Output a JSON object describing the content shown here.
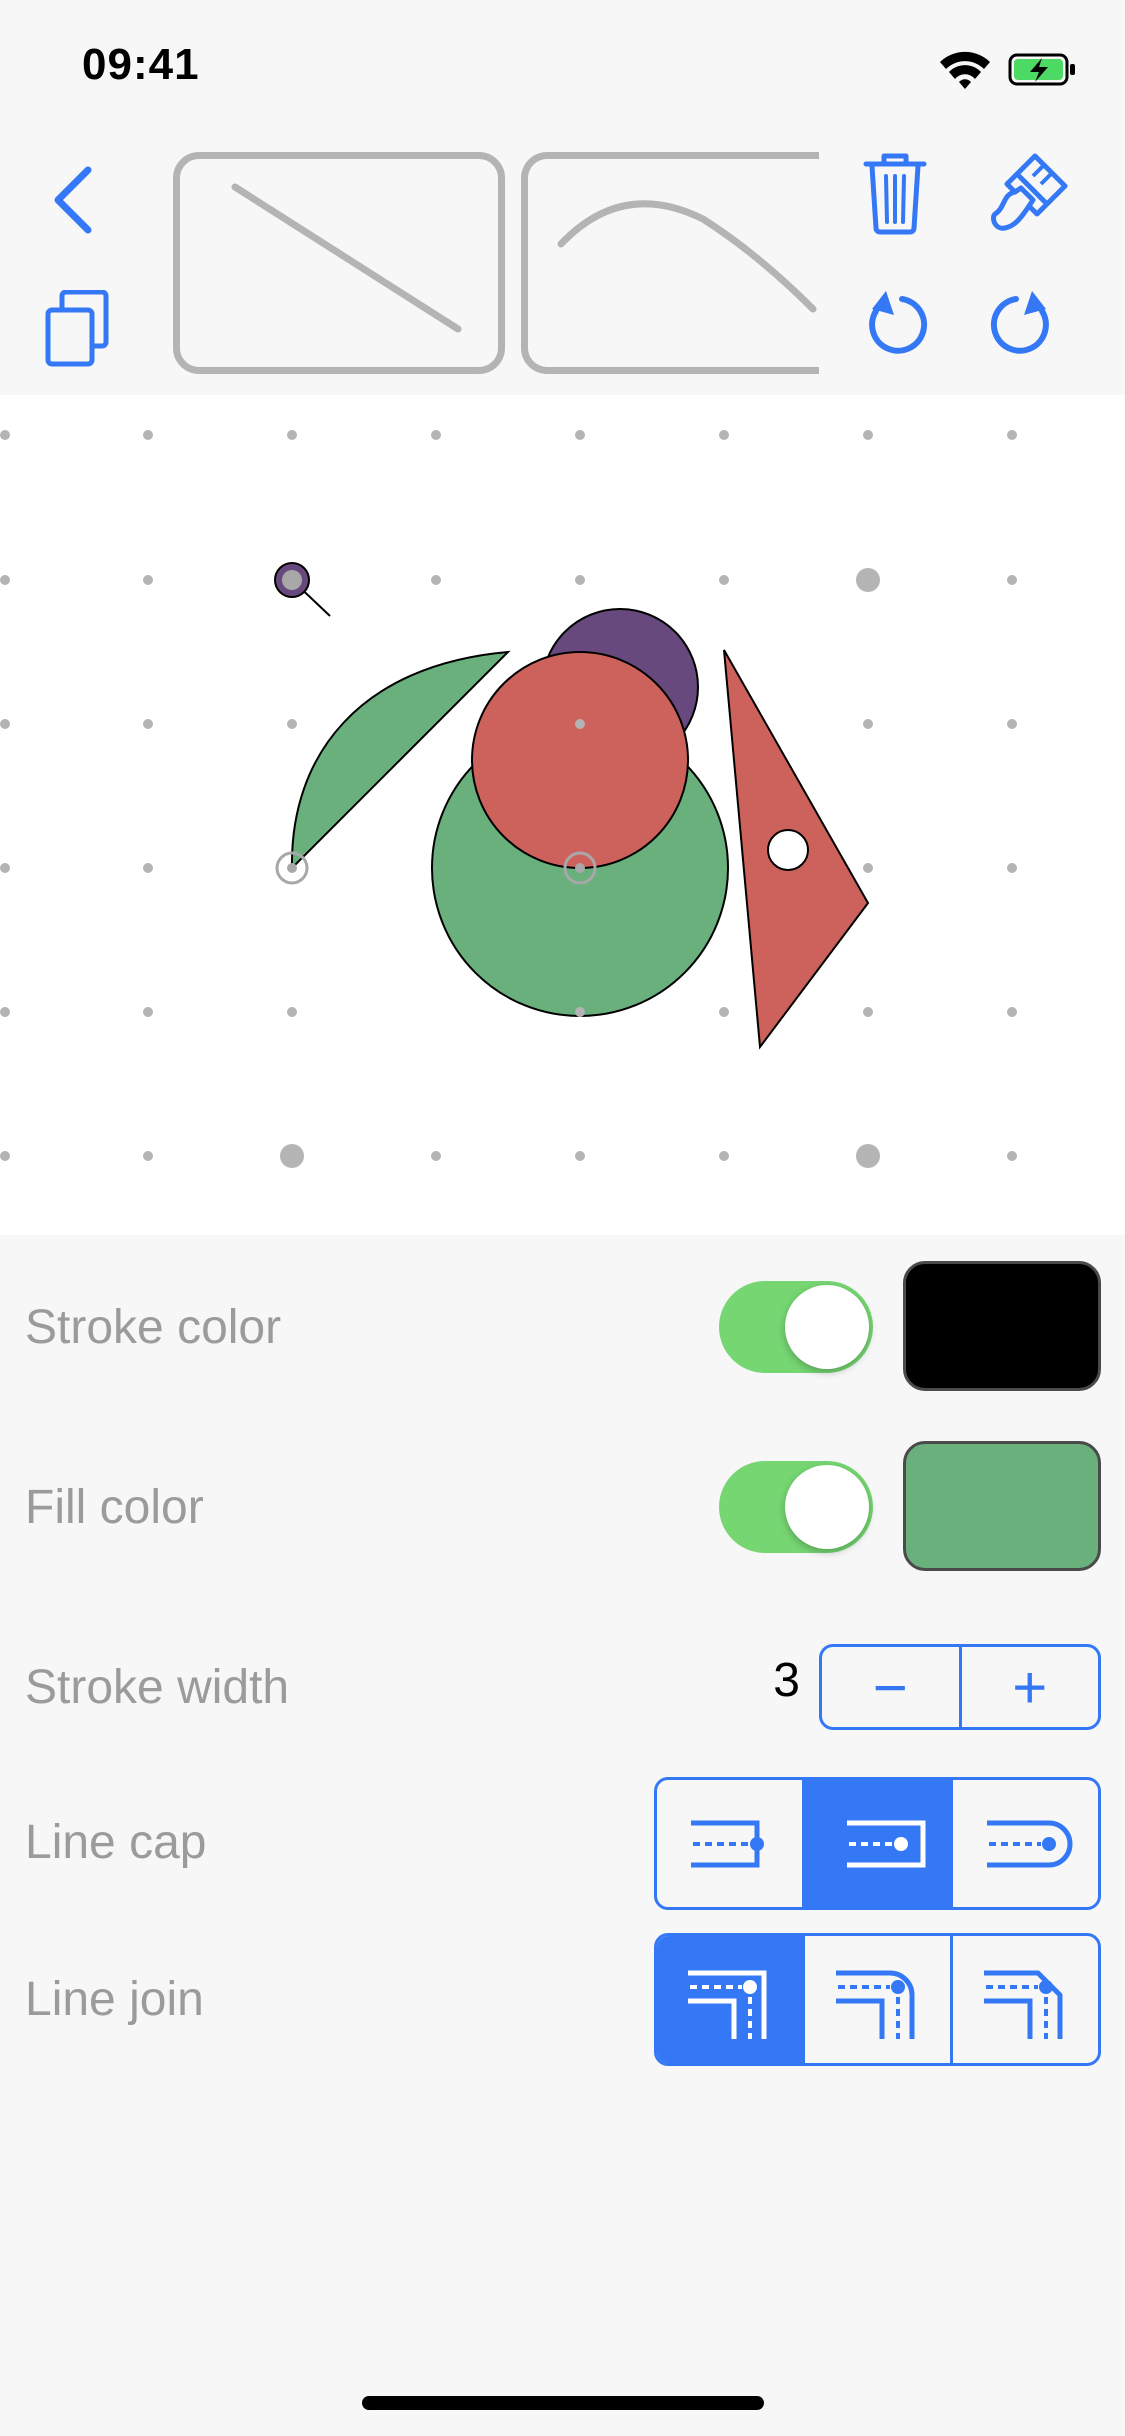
{
  "status": {
    "time": "09:41"
  },
  "toolbar": {
    "back_icon": "chevron-left-icon",
    "duplicate_icon": "duplicate-icon",
    "delete_icon": "trash-icon",
    "paint_icon": "paintbrush-icon",
    "undo_icon": "undo-icon",
    "redo_icon": "redo-icon",
    "shape_thumbnails": [
      "line",
      "curve"
    ]
  },
  "properties": {
    "stroke_color": {
      "label": "Stroke color",
      "enabled": true,
      "color": "#000000"
    },
    "fill_color": {
      "label": "Fill color",
      "enabled": true,
      "color": "#69b07c"
    },
    "stroke_width": {
      "label": "Stroke width",
      "value": "3",
      "decrement": "−",
      "increment": "+"
    },
    "line_cap": {
      "label": "Line cap",
      "options": [
        "butt",
        "square",
        "round"
      ],
      "selected": "square"
    },
    "line_join": {
      "label": "Line join",
      "options": [
        "miter",
        "round",
        "bevel"
      ],
      "selected": "miter"
    }
  },
  "colors": {
    "accent": "#3478f6",
    "toggle_on": "#76d672",
    "shape_green": "#69b07c",
    "shape_red": "#cd625c",
    "shape_purple": "#67497e"
  }
}
